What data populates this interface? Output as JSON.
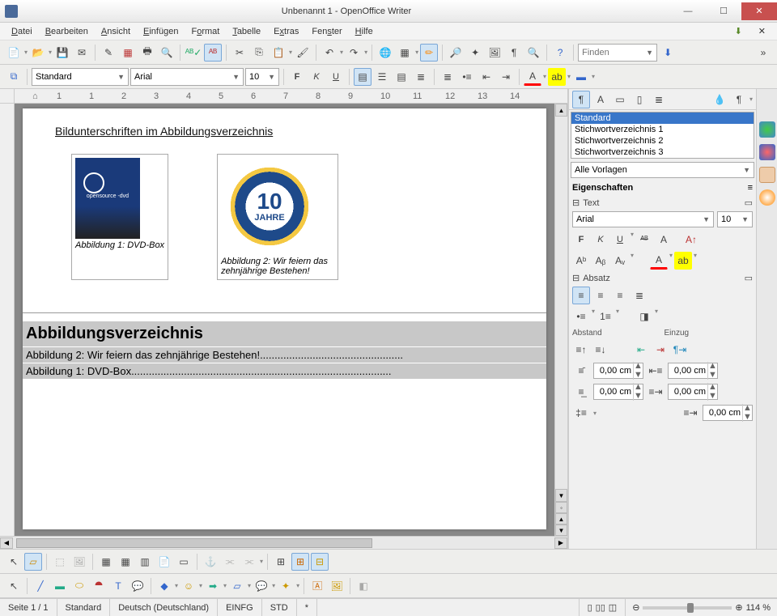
{
  "window": {
    "title": "Unbenannt 1 - OpenOffice Writer"
  },
  "menu": {
    "datei": "Datei",
    "bearbeiten": "Bearbeiten",
    "ansicht": "Ansicht",
    "einfuegen": "Einfügen",
    "format": "Format",
    "tabelle": "Tabelle",
    "extras": "Extras",
    "fenster": "Fenster",
    "hilfe": "Hilfe"
  },
  "toolbar2": {
    "style": "Standard",
    "font": "Arial",
    "size": "10",
    "finden_placeholder": "Finden"
  },
  "ruler": {
    "marks": [
      "1",
      "1",
      "2",
      "3",
      "4",
      "5",
      "6",
      "7",
      "8",
      "9",
      "10",
      "11",
      "12",
      "13",
      "14"
    ]
  },
  "document": {
    "title": "Bildunterschriften im Abbildungsverzeichnis",
    "fig1_txt": "opensource -dvd",
    "fig1_cap": "Abbildung 1: DVD-Box",
    "seal_num": "10",
    "seal_txt": "JAHRE",
    "fig2_cap": "Abbildung 2: Wir feiern das zehnjährige Bestehen!",
    "index_title": "Abbildungsverzeichnis",
    "idx1": "Abbildung 2: Wir feiern das zehnjährige Bestehen!.................................................",
    "idx2": "Abbildung 1: DVD-Box........................................................................................."
  },
  "sidebar": {
    "list": [
      "Standard",
      "Stichwortverzeichnis 1",
      "Stichwortverzeichnis 2",
      "Stichwortverzeichnis 3"
    ],
    "list_selected": 0,
    "filter": "Alle Vorlagen",
    "props_title": "Eigenschaften",
    "text_title": "Text",
    "font": "Arial",
    "size": "10",
    "absatz_title": "Absatz",
    "abstand": "Abstand",
    "einzug": "Einzug",
    "spacing": "0,00 cm"
  },
  "status": {
    "seite": "Seite 1 / 1",
    "standard": "Standard",
    "sprache": "Deutsch (Deutschland)",
    "einfg": "EINFG",
    "std": "STD",
    "star": "*",
    "zoom": "114 %"
  }
}
